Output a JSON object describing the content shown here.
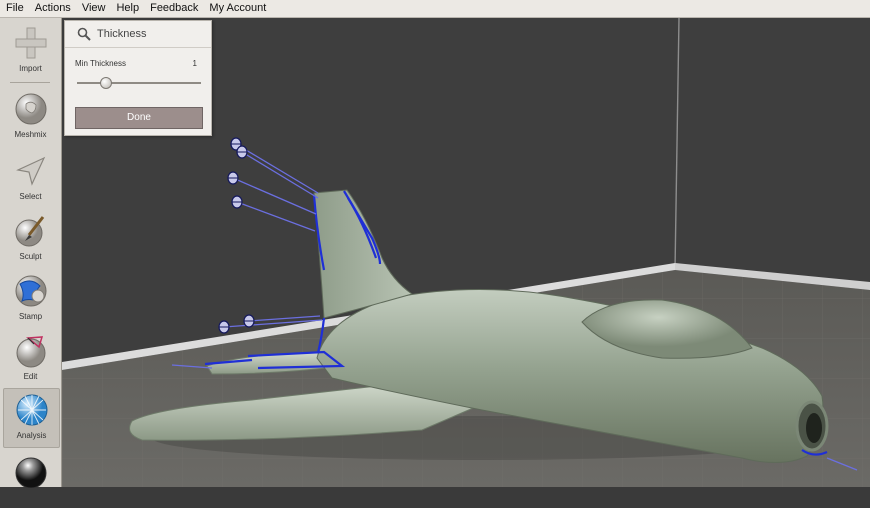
{
  "menu": [
    "File",
    "Actions",
    "View",
    "Help",
    "Feedback",
    "My Account"
  ],
  "tools": [
    {
      "label": "Import",
      "icon": "plus-icon"
    },
    {
      "label": "Meshmix",
      "icon": "meshmix-bust-icon"
    },
    {
      "label": "Select",
      "icon": "select-arrow-icon"
    },
    {
      "label": "Sculpt",
      "icon": "sculpt-brush-icon"
    },
    {
      "label": "Stamp",
      "icon": "stamp-icon"
    },
    {
      "label": "Edit",
      "icon": "edit-sphere-icon"
    },
    {
      "label": "Analysis",
      "icon": "analysis-mesh-icon",
      "active": true
    },
    {
      "label": "",
      "icon": "shaders-sphere-icon"
    }
  ],
  "panel": {
    "title": "Thickness",
    "param_label": "Min Thickness",
    "param_value": "1",
    "slider_fraction": 0.23,
    "done_label": "Done"
  },
  "colors": {
    "highlight": "#1f2fd6",
    "mesh": "#9aa896",
    "wall": "#3f3f3f",
    "floor": "#5e5d59"
  }
}
